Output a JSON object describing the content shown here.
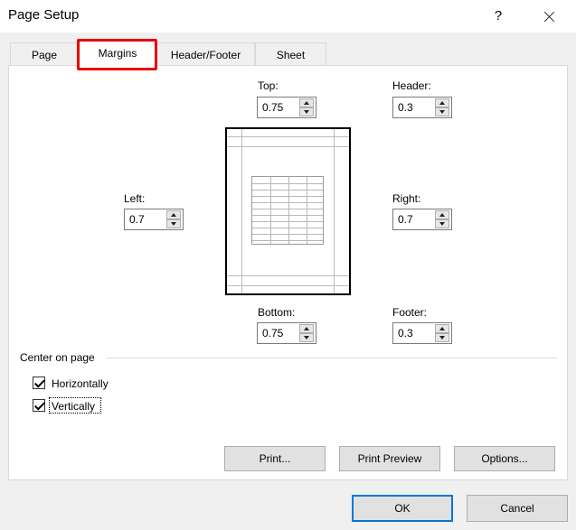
{
  "window": {
    "title": "Page Setup",
    "help_label": "?"
  },
  "tabs": [
    {
      "label": "Page"
    },
    {
      "label": "Margins"
    },
    {
      "label": "Header/Footer"
    },
    {
      "label": "Sheet"
    }
  ],
  "active_tab": "Margins",
  "margins": {
    "top": {
      "label": "Top:",
      "value": "0.75"
    },
    "header": {
      "label": "Header:",
      "value": "0.3"
    },
    "left": {
      "label": "Left:",
      "value": "0.7"
    },
    "right": {
      "label": "Right:",
      "value": "0.7"
    },
    "bottom": {
      "label": "Bottom:",
      "value": "0.75"
    },
    "footer": {
      "label": "Footer:",
      "value": "0.3"
    }
  },
  "center_on_page": {
    "title": "Center on page",
    "horizontally": {
      "label": "Horizontally",
      "checked": true
    },
    "vertically": {
      "label": "Vertically",
      "checked": true
    }
  },
  "buttons": {
    "print": "Print...",
    "print_preview": "Print Preview",
    "options": "Options...",
    "ok": "OK",
    "cancel": "Cancel"
  },
  "colors": {
    "highlight": "#e8000a",
    "default_button_border": "#0078d7"
  }
}
